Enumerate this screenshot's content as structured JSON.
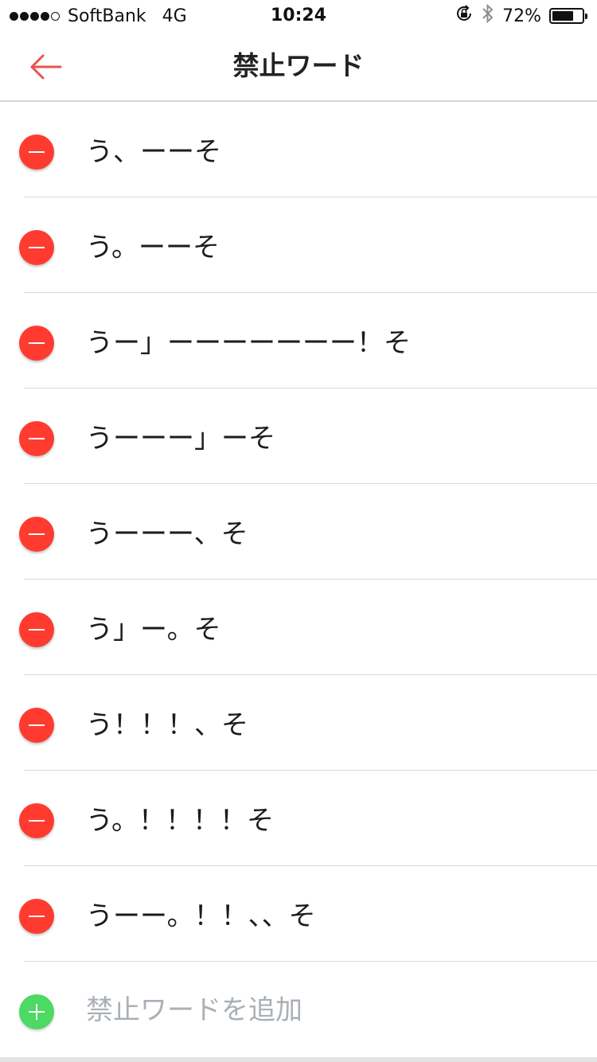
{
  "status_bar": {
    "carrier": "SoftBank",
    "network": "4G",
    "time": "10:24",
    "battery_percent": "72%",
    "battery_level": 0.72,
    "signal_bars_filled": 4,
    "signal_bars_total": 5,
    "icons": [
      "rotation-lock-icon",
      "bluetooth-icon",
      "battery-icon"
    ]
  },
  "nav": {
    "title": "禁止ワード",
    "back_icon": "arrow-left-icon"
  },
  "words": [
    "う、ーーそ",
    "う。ーーそ",
    "うー」ーーーーーーー！そ",
    "うーーー」ーそ",
    "うーーー、そ",
    "う」ー。そ",
    "う！！！、そ",
    "う。！！！！そ",
    "うーー。！！、、そ"
  ],
  "add_row": {
    "label": "禁止ワードを追加"
  },
  "colors": {
    "accent": "#e8534f",
    "remove": "#ff3b30",
    "add": "#4cd964",
    "placeholder": "#a9b0b6"
  }
}
